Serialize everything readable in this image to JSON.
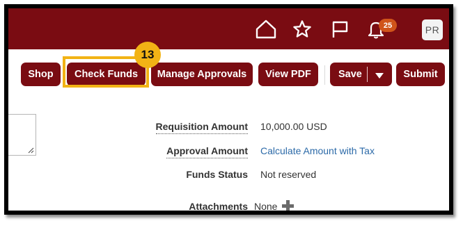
{
  "header": {
    "icons": [
      "home-icon",
      "star-icon",
      "flag-icon",
      "bell-icon"
    ],
    "notification_count": "25",
    "user_initials": "PR",
    "brand_color": "#7a0c12"
  },
  "toolbar": {
    "shop_label": "Shop",
    "check_funds_label": "Check Funds",
    "manage_approvals_label": "Manage Approvals",
    "view_pdf_label": "View PDF",
    "save_label": "Save",
    "submit_label": "Submit"
  },
  "callout": {
    "step_number": "13",
    "highlight_color": "#f2b315"
  },
  "details": {
    "requisition_amount_label": "Requisition Amount",
    "requisition_amount_value": "10,000.00  USD",
    "approval_amount_label": "Approval Amount",
    "approval_amount_value": "Calculate Amount with Tax",
    "funds_status_label": "Funds Status",
    "funds_status_value": "Not reserved",
    "attachments_label": "Attachments",
    "attachments_value": "None"
  }
}
